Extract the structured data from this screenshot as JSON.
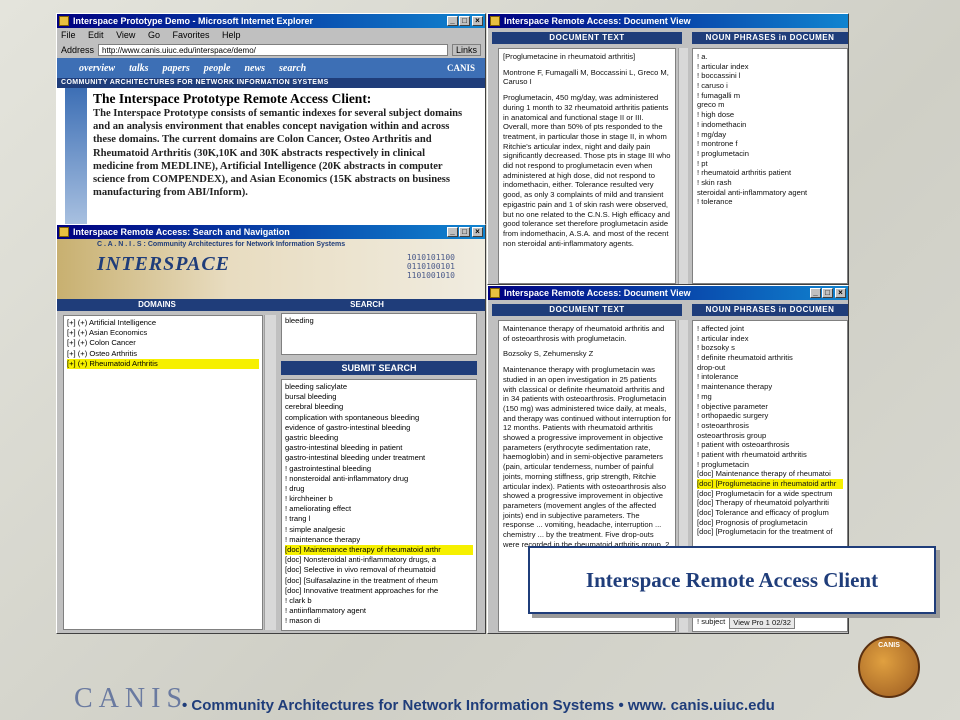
{
  "ie_window": {
    "title": "Interspace Prototype Demo - Microsoft Internet Explorer",
    "menu": [
      "File",
      "Edit",
      "View",
      "Go",
      "Favorites",
      "Help"
    ],
    "address_label": "Address",
    "address": "http://www.canis.uiuc.edu/interspace/demo/",
    "links_label": "Links",
    "nav": [
      "overview",
      "talks",
      "papers",
      "people",
      "news",
      "search"
    ],
    "canis_badge": "CANIS",
    "banner": "COMMUNITY ARCHITECTURES FOR NETWORK INFORMATION SYSTEMS",
    "heading": "The Interspace Prototype Remote Access Client:",
    "body": "The Interspace Prototype consists of semantic indexes for several subject domains and an analysis environment that enables concept navigation within and across these domains. The current domains are Colon Cancer, Osteo Arthritis and Rheumatoid Arthritis (30K,10K and 30K abstracts respectively in clinical medicine from MEDLINE), Artificial Intelligence (20K abstracts in computer science from COMPENDEX), and Asian Economics (15K abstracts on business manufacturing from ABI/Inform)."
  },
  "search_window": {
    "title": "Interspace Remote Access: Search and Navigation",
    "canis_line": "C . A . N . I . S :  Community Architectures for Network Information Systems",
    "logo": "INTERSPACE",
    "tab_domains": "DOMAINS",
    "tab_search": "SEARCH",
    "domains": [
      "[+] (+) Artificial Intelligence",
      "[+] (+) Asian Economics",
      "[+] (+) Colon Cancer",
      "[+] (+) Osteo Arthritis",
      "[+] (+) Rheumatoid Arthritis"
    ],
    "search_value": "bleeding",
    "submit": "SUBMIT SEARCH",
    "results": [
      "bleeding salicylate",
      "bursal bleeding",
      "cerebral bleeding",
      "complication with spontaneous bleeding",
      "evidence of gastro-intestinal bleeding",
      "gastric bleeding",
      "gastro-intestinal bleeding in patient",
      "gastro-intestinal bleeding under treatment",
      "! gastrointestinal bleeding",
      "  ! nonsteroidal anti-inflammatory drug",
      "  ! drug",
      "  ! kirchheiner b",
      "  ! ameliorating effect",
      "  ! trang l",
      "  ! simple analgesic",
      "    ! maintenance therapy",
      "      [doc] Maintenance therapy of rheumatoid arthr",
      "      [doc] Nonsteroidal anti-inflammatory drugs, a",
      "      [doc] Selective in vivo removal of rheumatoid",
      "      [doc] [Sulfasalazine in the treatment of rheum",
      "      [doc] Innovative treatment approaches for rhe",
      "  ! clark b",
      "  ! antiinflammatory agent",
      "  ! mason di"
    ]
  },
  "doc1": {
    "title": "Interspace Remote Access: Document View",
    "hdr_text": "DOCUMENT TEXT",
    "hdr_np": "NOUN PHRASES in DOCUMEN",
    "paras": [
      "[Proglumetacine in rheumatoid arthritis]",
      "Montrone F, Fumagalli M, Boccassini L, Greco M, Caruso I",
      "Proglumetacin, 450 mg/day, was administered during 1 month to 32 rheumatoid arthritis patients in anatomical and functional stage II or III. Overall, more than 50% of pts responded to the treatment, in particular those in stage II, in whom Ritchie's articular index, night and daily pain significantly decreased. Those pts in stage III who did not respond to proglumetacin even when administered at high dose, did not respond to indomethacin, either. Tolerance resulted very good, as only 3 complaints of mild and transient epigastric pain and 1 of skin rash were observed, but no one related to the C.N.S. High efficacy and good tolerance set therefore proglumetacin aside from indomethacin, A.S.A. and most of the recent non steroidal anti-inflammatory agents."
    ],
    "nps": [
      "! a.",
      "! articular index",
      "! boccassini l",
      "! caruso i",
      "! fumagalli m",
      "   greco m",
      "! high dose",
      "! indomethacin",
      "! mg/day",
      "! montrone f",
      "! proglumetacin",
      "! pt",
      "! rheumatoid arthritis patient",
      "! skin rash",
      "   steroidal anti-inflammatory agent",
      "! tolerance"
    ]
  },
  "doc2": {
    "title": "Interspace Remote Access: Document View",
    "hdr_text": "DOCUMENT TEXT",
    "hdr_np": "NOUN PHRASES in DOCUMEN",
    "paras": [
      "Maintenance therapy of rheumatoid arthritis and of osteoarthrosis with proglumetacin.",
      "Bozsoky S, Zehumensky Z",
      "Maintenance therapy with proglumetacin was studied in an open investigation in 25 patients with classical or definite rheumatoid arthritis and in 34 patients with osteoarthrosis. Proglumetacin (150 mg) was administered twice daily, at meals, and therapy was continued without interruption for 12 months. Patients with rheumatoid arthritis showed a progressive improvement in objective parameters (erythrocyte sedimentation rate, haemoglobin) and in semi-objective parameters (pain, articular tenderness, number of painful joints, morning stiffness, grip strength, Ritchie articular index). Patients with osteoarthrosis also showed a progressive improvement in objective parameters (movement angles of the affected joints) end in subjective parameters. The response ... vomiting, headache, interruption ... chemistry ... by the treatment. Five drop-outs were recorded in the rheumatoid arthritis group. 2"
    ],
    "nps": [
      "! affected joint",
      "! articular index",
      "! bozsoky s",
      "! definite rheumatoid arthritis",
      "   drop-out",
      "! intolerance",
      "! maintenance therapy",
      "! mg",
      "! objective parameter",
      "! orthopaedic surgery",
      "! osteoarthrosis",
      "   osteoarthrosis group",
      "! patient with osteoarthrosis",
      "! patient with rheumatoid arthritis",
      "! proglumetacin",
      "   [doc] Maintenance therapy of rheumatoi",
      "   [doc] [Proglumetacine in rheumatoid arthr",
      "   [doc] Proglumetacin for a wide spectrum",
      "   [doc] Therapy of rheumatoid polyarthriti",
      "   [doc] Tolerance and efficacy of proglum",
      "   [doc] Prognosis of proglumetacin",
      "   [doc] [Proglumetacin for the treatment of"
    ],
    "status": "View Pro 1 02/32",
    "last_np": "! subject"
  },
  "caption": "Interspace Remote Access Client",
  "footer": {
    "brand": "CANIS",
    "tagline": "• Community Architectures for Network Information Systems • www. canis.uiuc.edu",
    "seal": "CANIS"
  },
  "colors": {
    "navy": "#1f3d7a",
    "highlight": "#f6f000",
    "title_bar": "#000080"
  }
}
